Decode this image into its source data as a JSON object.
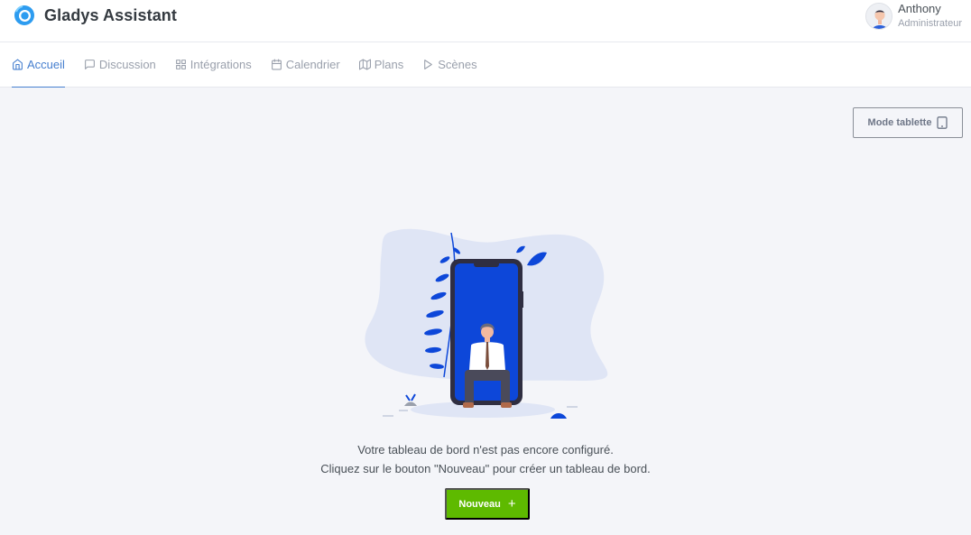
{
  "app": {
    "title": "Gladys Assistant"
  },
  "user": {
    "name": "Anthony",
    "role": "Administrateur"
  },
  "nav": {
    "items": [
      {
        "label": "Accueil",
        "icon": "home-icon",
        "active": true
      },
      {
        "label": "Discussion",
        "icon": "message-square-icon",
        "active": false
      },
      {
        "label": "Intégrations",
        "icon": "grid-icon",
        "active": false
      },
      {
        "label": "Calendrier",
        "icon": "calendar-icon",
        "active": false
      },
      {
        "label": "Plans",
        "icon": "map-icon",
        "active": false
      },
      {
        "label": "Scènes",
        "icon": "play-icon",
        "active": false
      }
    ]
  },
  "dashboard": {
    "tablet_mode_label": "Mode tablette",
    "empty_message_line1": "Votre tableau de bord n'est pas encore configuré.",
    "empty_message_line2": "Cliquez sur le bouton \"Nouveau\" pour créer un tableau de bord.",
    "new_button_label": "Nouveau",
    "new_button_icon": "+"
  },
  "colors": {
    "accent": "#467fcf",
    "success": "#5eba00",
    "illustration_blue": "#0d47d9",
    "illustration_bg": "#dfe5f5"
  }
}
